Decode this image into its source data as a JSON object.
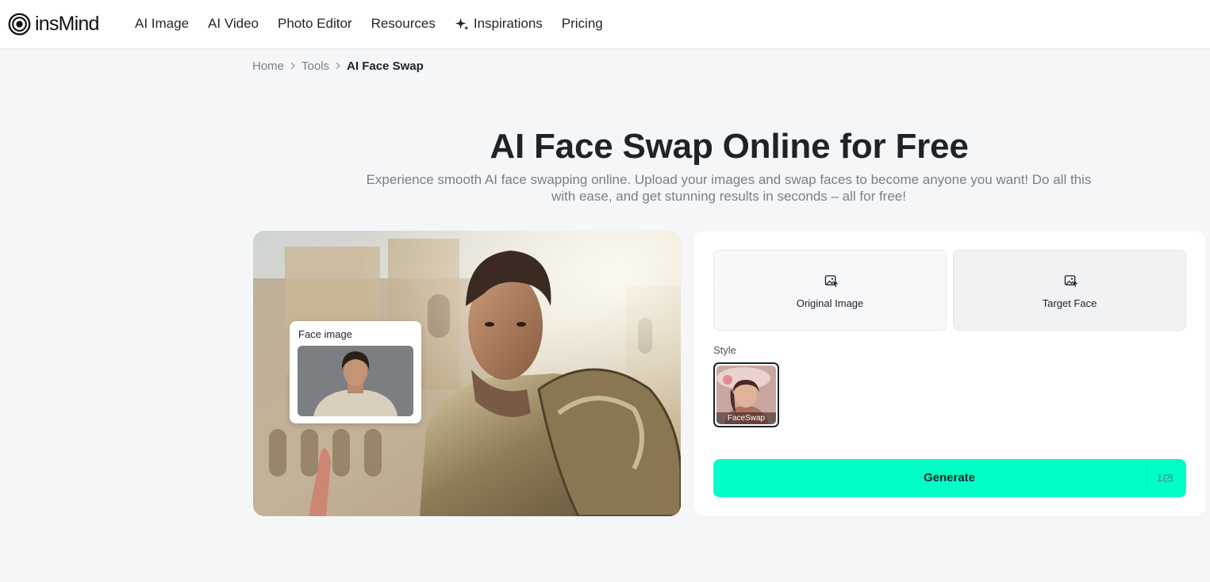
{
  "header": {
    "logo_text": "insMind",
    "logo_icon": "insmind-logo-icon",
    "nav": [
      {
        "label": "AI Image"
      },
      {
        "label": "AI Video"
      },
      {
        "label": "Photo Editor"
      },
      {
        "label": "Resources"
      },
      {
        "label": "Inspirations",
        "icon": "sparkle-icon"
      },
      {
        "label": "Pricing"
      }
    ]
  },
  "breadcrumb": {
    "items": [
      "Home",
      "Tools",
      "AI Face Swap"
    ],
    "separator_icon": "chevron-right-icon"
  },
  "hero": {
    "title": "AI Face Swap Online for Free",
    "subtitle": "Experience smooth AI face swapping online. Upload your images and swap faces to become anyone you want! Do all this with ease, and get stunning results in seconds – all for free!"
  },
  "preview": {
    "face_card_label": "Face image"
  },
  "panel": {
    "original_label": "Original Image",
    "target_label": "Target Face",
    "upload_icon": "image-upload-icon",
    "style_label": "Style",
    "styles": [
      {
        "name": "FaceSwap",
        "selected": true
      }
    ],
    "generate_label": "Generate",
    "generate_cost": "1",
    "credit_icon": "credit-icon"
  },
  "colors": {
    "accent": "#00ffc6",
    "page_bg": "#f5f6f7",
    "text": "#1f2329",
    "muted": "#7a7f87"
  }
}
